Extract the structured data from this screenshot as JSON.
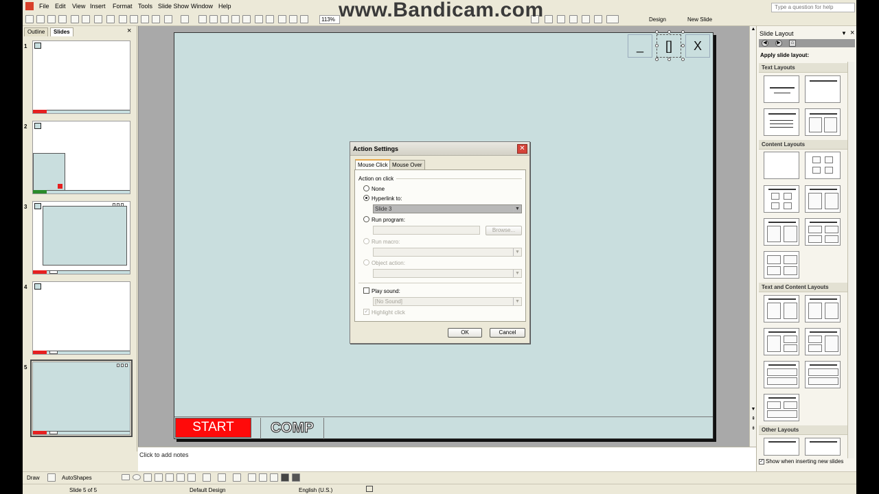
{
  "app": {
    "menu": [
      "File",
      "Edit",
      "View",
      "Insert",
      "Format",
      "Tools",
      "Slide Show",
      "Window",
      "Help"
    ],
    "help_placeholder": "Type a question for help",
    "zoom": "113%",
    "toolbar_design": "Design",
    "toolbar_new_slide": "New Slide",
    "watermark": "www.Bandicam.com"
  },
  "slides_panel": {
    "tabs": [
      "Outline",
      "Slides"
    ],
    "close": "×",
    "numbers": [
      "1",
      "2",
      "3",
      "4",
      "5"
    ]
  },
  "slide": {
    "start_label": "START",
    "comp_label": "COMP",
    "min_label": "_",
    "max_label": "[]",
    "close_label": "X"
  },
  "notes": {
    "placeholder": "Click to add notes"
  },
  "drawbar": {
    "draw": "Draw",
    "autoshapes": "AutoShapes"
  },
  "status": {
    "slide": "Slide 5 of 5",
    "design": "Default Design",
    "language": "English (U.S.)"
  },
  "taskpane": {
    "title": "Slide Layout",
    "apply": "Apply slide layout:",
    "sections": [
      "Text Layouts",
      "Content Layouts",
      "Text and Content Layouts",
      "Other Layouts"
    ],
    "show_checkbox": "Show when inserting new slides"
  },
  "dialog": {
    "title": "Action Settings",
    "tabs": [
      "Mouse Click",
      "Mouse Over"
    ],
    "group_label": "Action on click",
    "none": "None",
    "hyperlink": "Hyperlink to:",
    "hyperlink_value": "Slide 3",
    "run_program": "Run program:",
    "browse": "Browse...",
    "run_macro": "Run macro:",
    "object_action": "Object action:",
    "play_sound": "Play sound:",
    "sound_value": "[No Sound]",
    "highlight": "Highlight click",
    "ok": "OK",
    "cancel": "Cancel"
  }
}
